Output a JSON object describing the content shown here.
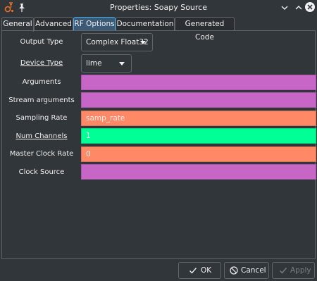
{
  "window": {
    "title": "Properties: Soapy Source"
  },
  "tabs": [
    {
      "label": "General"
    },
    {
      "label": "Advanced"
    },
    {
      "label": "RF Options"
    },
    {
      "label": "Documentation"
    },
    {
      "label": "Generated Code"
    }
  ],
  "params": [
    {
      "label": "Output Type",
      "value": "Complex Float32",
      "kind": "combo",
      "color": "#31363b"
    },
    {
      "label": "Device Type",
      "value": "lime",
      "kind": "combo",
      "color": "#31363b"
    },
    {
      "label": "Arguments",
      "value": "",
      "kind": "text",
      "color": "#c866c8"
    },
    {
      "label": "Stream arguments",
      "value": "",
      "kind": "text",
      "color": "#c866c8"
    },
    {
      "label": "Sampling Rate",
      "value": "samp_rate",
      "kind": "text",
      "color": "#ff8866"
    },
    {
      "label": "Num Channels",
      "value": "1",
      "kind": "text",
      "color": "#00ff95"
    },
    {
      "label": "Master Clock Rate",
      "value": "0",
      "kind": "text",
      "color": "#ff8866"
    },
    {
      "label": "Clock Source",
      "value": "",
      "kind": "text",
      "color": "#c866c8"
    }
  ],
  "buttons": {
    "ok": "OK",
    "cancel": "Cancel",
    "apply": "Apply"
  }
}
